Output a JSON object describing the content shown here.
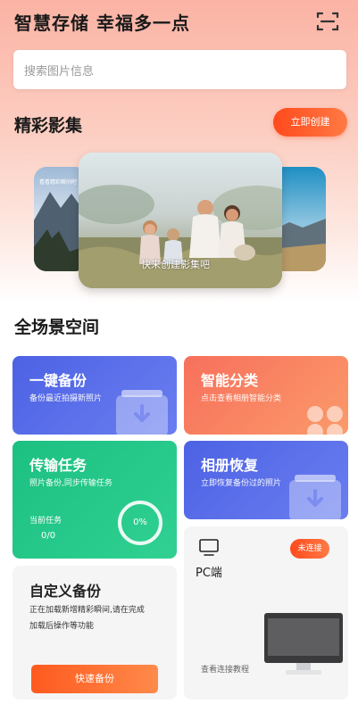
{
  "header": {
    "title": "智慧存储 幸福多一点",
    "scan_icon": "scan-icon"
  },
  "search": {
    "placeholder": "搜索图片信息"
  },
  "album": {
    "title": "精彩影集",
    "create_label": "立即创建",
    "left_caption": "看看精彩瞬间吧",
    "main_caption": "快来创建影集吧"
  },
  "scene": {
    "title": "全场景空间"
  },
  "tiles": {
    "backup": {
      "title": "一键备份",
      "sub": "备份最近拍摄新照片"
    },
    "classify": {
      "title": "智能分类",
      "sub": "点击查看相册智能分类"
    },
    "transfer": {
      "title": "传输任务",
      "sub": "照片备份,同步传输任务",
      "current_label": "当前任务",
      "current_value": "0/0",
      "progress": "0%"
    },
    "restore": {
      "title": "相册恢复",
      "sub": "立即恢复备份过的照片"
    },
    "custom": {
      "title": "自定义备份",
      "desc1": "正在加载新增精彩瞬间,请在完成",
      "desc2": "加载后操作等功能",
      "button": "快速备份"
    },
    "pc": {
      "title": "PC端",
      "badge": "未连接",
      "tutorial": "查看连接教程"
    }
  },
  "colors": {
    "accent": "#ff5a1f",
    "blue": "#5268e8",
    "orange": "#fb8158",
    "green": "#22c27c"
  }
}
